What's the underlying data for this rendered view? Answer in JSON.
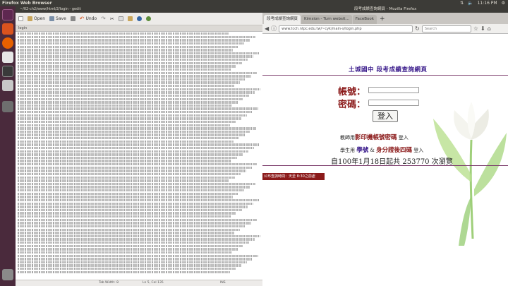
{
  "topbar": {
    "title": "Firefox Web Browser",
    "time": "11:16 PM"
  },
  "gedit": {
    "title": "~/02-ch2/www/html/2/login - gedit",
    "toolbar": {
      "open": "Open",
      "save": "Save",
      "undo": "Undo"
    },
    "tab": "login",
    "status": {
      "mode": "Tab Width: 8",
      "position": "Ln 5, Col 135",
      "ins": "INS"
    }
  },
  "firefox": {
    "title": "段考成績查詢網頁 - Mozilla Firefox",
    "tabs": [
      "段考成績查詢網頁",
      "Kimsion - Turn websit...",
      "FaceBook"
    ],
    "url": "www.tcch.ntpc.edu.tw/~cyk/main-s/login.php",
    "search_placeholder": "Search"
  },
  "page": {
    "title": "土城國中 段考成績查詢網頁",
    "account_label": "帳號：",
    "password_label": "密碼：",
    "login_button": "登入",
    "hint1_prefix": "教師用",
    "hint1_bold": "影印機帳號密碼",
    "hint1_suffix": "登入",
    "hint2_prefix": "學生用",
    "hint2_bold1": "學號",
    "hint2_mid": "& ",
    "hint2_bold2": "身分證後四碼",
    "hint2_suffix": "登入",
    "counter_prefix": "自100年1月18日起共",
    "counter_value": "253770",
    "counter_suffix": "次瀏覽",
    "marquee": "公布查詢時間：天至 8:30之前處"
  }
}
